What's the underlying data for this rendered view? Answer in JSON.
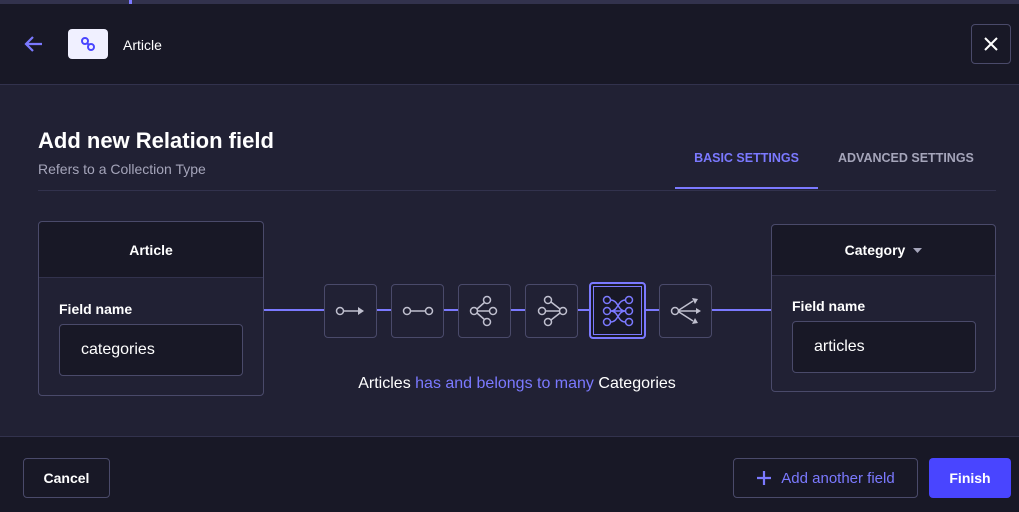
{
  "header": {
    "title": "Article"
  },
  "modal": {
    "title": "Add new Relation field",
    "subtitle": "Refers to a Collection Type",
    "tabs": [
      {
        "label": "BASIC SETTINGS",
        "active": true
      },
      {
        "label": "ADVANCED SETTINGS",
        "active": false
      }
    ]
  },
  "left": {
    "name": "Article",
    "field_label": "Field name",
    "field_value": "categories"
  },
  "right": {
    "name": "Category",
    "field_label": "Field name",
    "field_value": "articles"
  },
  "relations": [
    {
      "name": "one-way"
    },
    {
      "name": "one-to-one"
    },
    {
      "name": "one-to-many"
    },
    {
      "name": "many-to-one"
    },
    {
      "name": "many-to-many",
      "selected": true
    },
    {
      "name": "many-way"
    }
  ],
  "description": {
    "a": "Articles",
    "rel": "has and belongs to many",
    "b": "Categories"
  },
  "footer": {
    "cancel": "Cancel",
    "add": "Add another field",
    "finish": "Finish"
  },
  "colors": {
    "accent": "#7b79ff",
    "primary": "#4945ff"
  }
}
